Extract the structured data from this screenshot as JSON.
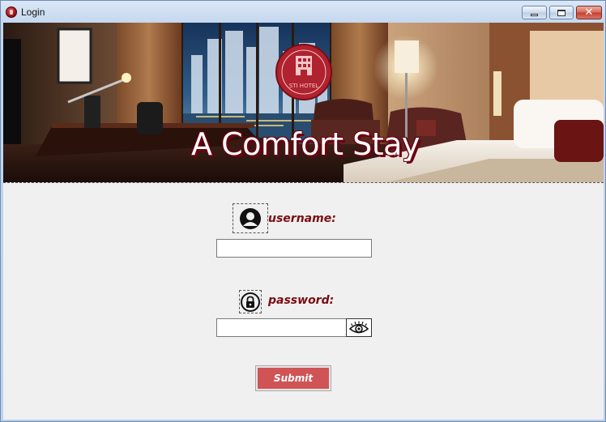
{
  "window": {
    "title": "Login",
    "controls": {
      "minimize": "minimize",
      "maximize": "maximize",
      "close": "✕"
    }
  },
  "banner": {
    "headline": "A Comfort Stay",
    "logo_text": "STI HOTEL"
  },
  "form": {
    "username_label": "username:",
    "username_value": "",
    "password_label": "password:",
    "password_value": "",
    "submit_label": "Submit"
  },
  "icons": {
    "app": "hotel-logo-icon",
    "user": "user-avatar-icon",
    "lock": "lock-icon",
    "eye": "eye-icon"
  },
  "colors": {
    "accent": "#7a0d12",
    "submit": "#d05455",
    "client_bg": "#f0f0f0"
  }
}
